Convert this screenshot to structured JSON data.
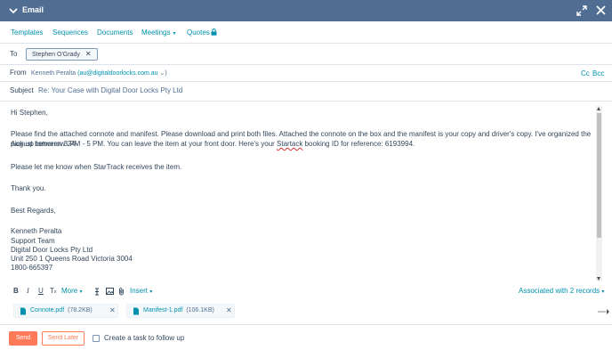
{
  "header": {
    "title": "Email"
  },
  "tabs": [
    {
      "label": "Templates"
    },
    {
      "label": "Sequences"
    },
    {
      "label": "Documents"
    },
    {
      "label": "Meetings",
      "caret": "▾"
    },
    {
      "label": "Quotes"
    }
  ],
  "to": {
    "label": "To",
    "recipient": "Stephen O'Grady",
    "remove": "✕"
  },
  "from": {
    "label": "From",
    "name": "Kenneth Peralta",
    "address": "(au@digitaldoorlocks.com.au",
    "caret": "⌄)",
    "cc": "Cc",
    "bcc": "Bcc"
  },
  "subject": {
    "label": "Subject",
    "value": "Re: Your Case with Digital Door Locks Pty Ltd"
  },
  "body": {
    "greeting": "Hi Stephen,",
    "para1_a": "Please find the attached connote and manifest. Please download and print both files. Attached the connote on the box and the manifest is your copy and driver's copy. I've organized the pick-up tomorrow 24-",
    "para1_b_pre": "August between 3 PM - 5 PM. You can leave the item at your front door. Here's your ",
    "para1_b_spell": "Startack",
    "para1_b_post": " booking ID for reference: 6193994.",
    "para2": "Please let me know when StarTrack receives the item.",
    "thanks": "Thank you.",
    "regards": "Best Regards,",
    "sig_name": "Kenneth Peralta",
    "sig_team": "Support Team",
    "sig_company": "Digital Door Locks Pty Ltd",
    "sig_address": "Unit 250 1 Queens Road Victoria 3004",
    "sig_phone": "1800-665397"
  },
  "toolbar": {
    "bold": "B",
    "italic": "I",
    "underline": "U",
    "clear": "T",
    "more": "More",
    "insert": "Insert",
    "caret": "▾",
    "associated": "Associated with 2 records"
  },
  "attachments": [
    {
      "name": "Connote.pdf",
      "size": "(78.2KB)",
      "remove": "✕"
    },
    {
      "name": "Manifest-1.pdf",
      "size": "(106.1KB)",
      "remove": "✕"
    }
  ],
  "footer": {
    "send": "Send",
    "send_later": "Send Later",
    "task_label": "Create a task to follow up"
  },
  "colors": {
    "header": "#506e91",
    "accent": "#0091ae",
    "send": "#ff7a59",
    "text": "#33475b"
  }
}
